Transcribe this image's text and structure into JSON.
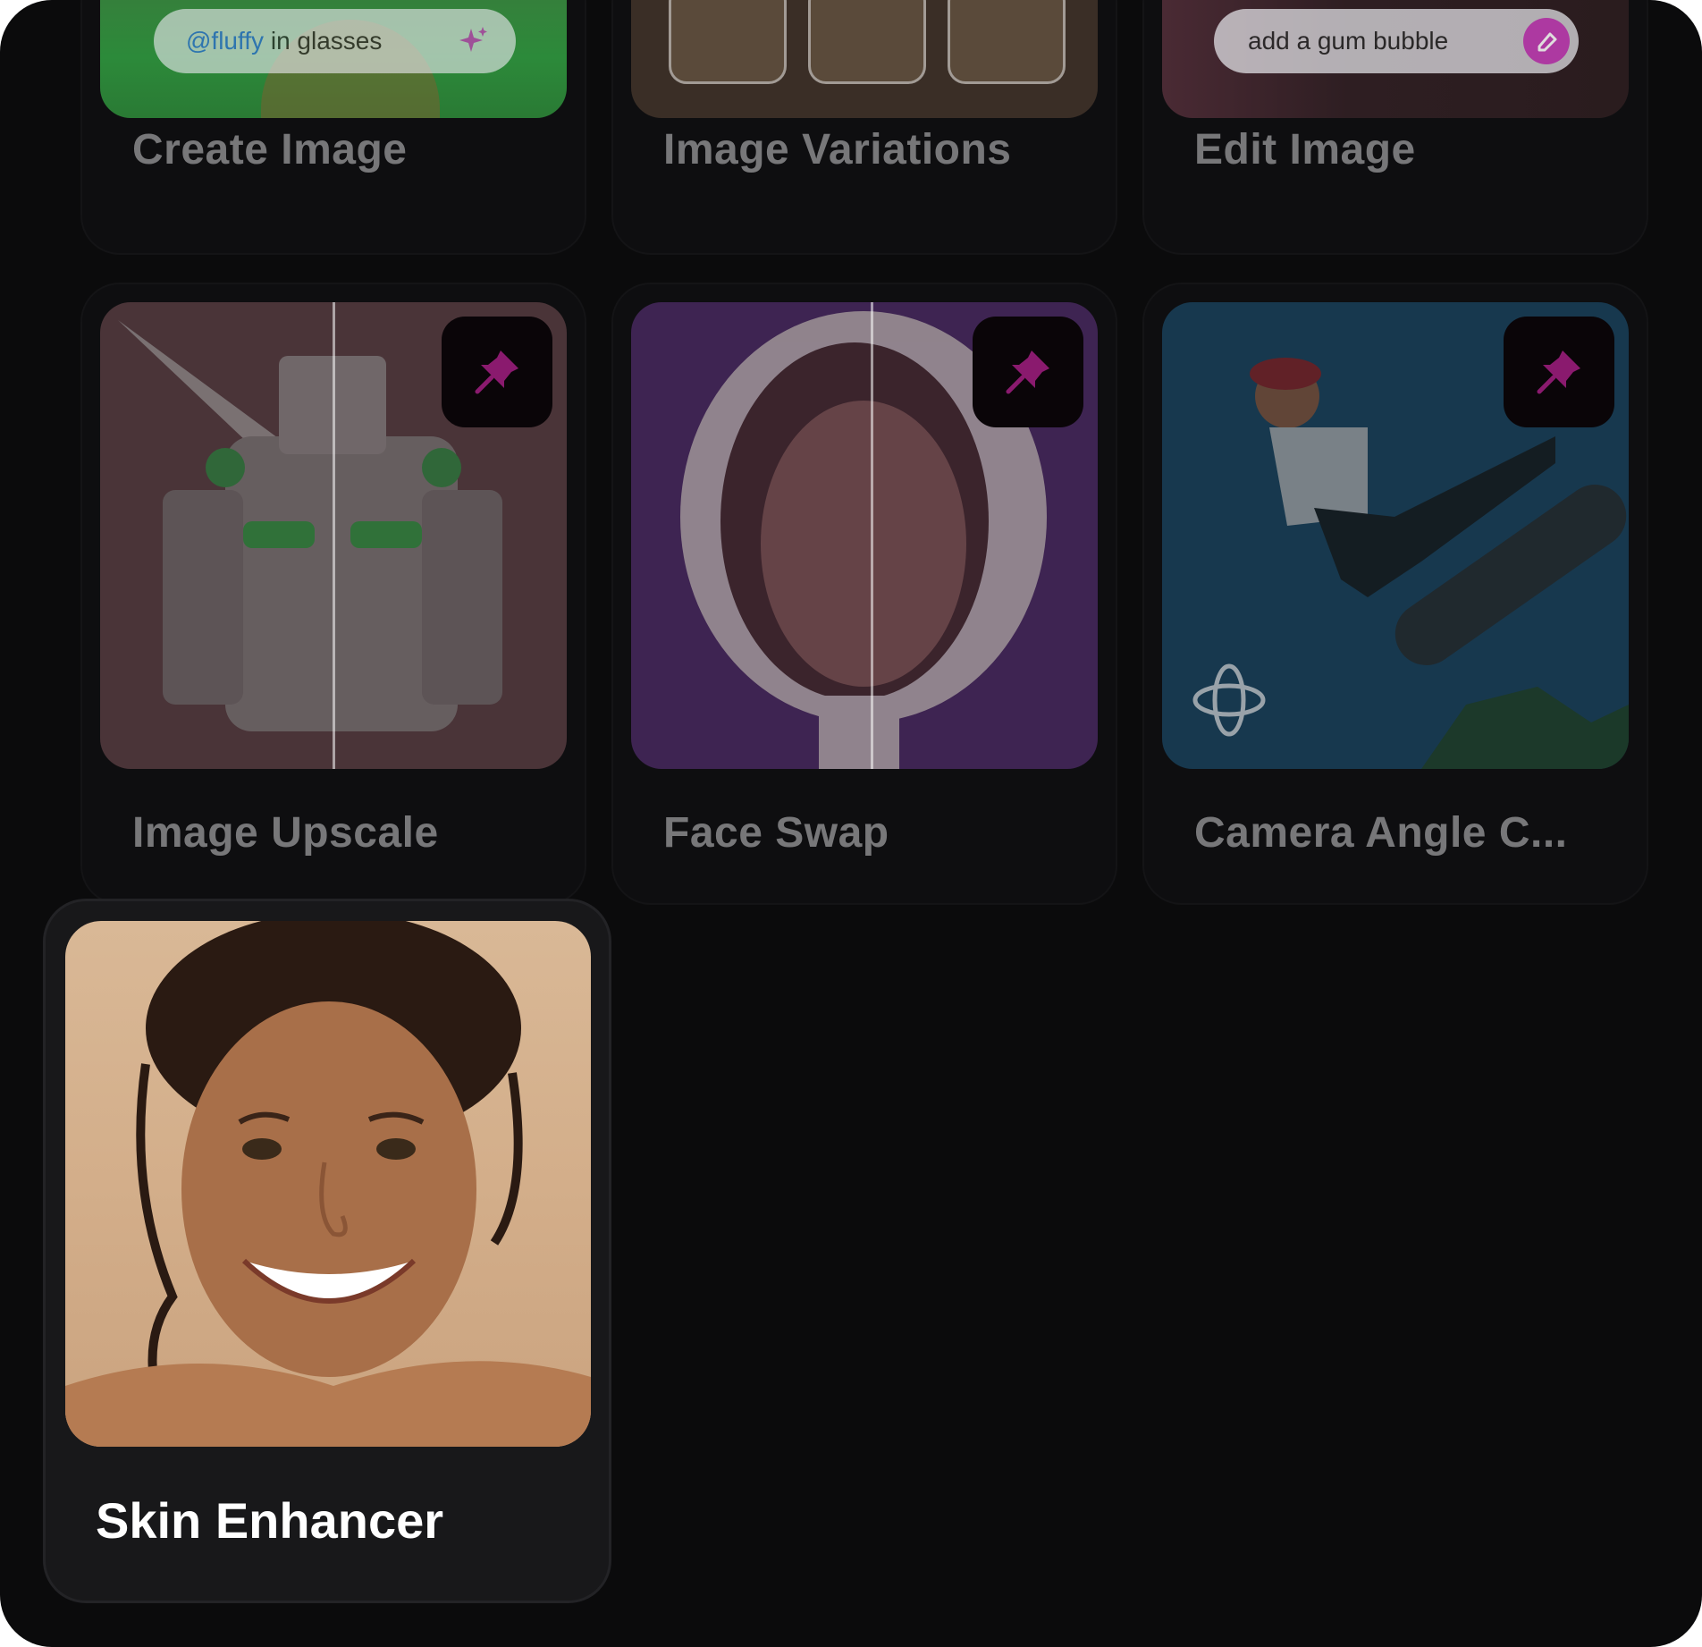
{
  "tools": [
    {
      "title": "Create Image",
      "prompt": {
        "mention": "@fluffy",
        "text": " in glasses"
      }
    },
    {
      "title": "Image Variations"
    },
    {
      "title": "Edit Image",
      "prompt": {
        "text": "add a gum bubble"
      }
    },
    {
      "title": "Image Upscale"
    },
    {
      "title": "Face Swap"
    },
    {
      "title": "Camera Angle C..."
    }
  ],
  "selected_tool": {
    "title": "Skin Enhancer"
  },
  "colors": {
    "background": "#0b0b0c",
    "card": "#0e0e10",
    "selected_card": "#18181a",
    "pin_accent": "#8a1a6e",
    "mention": "#2e6fd6",
    "edit_accent": "#c43fb8"
  },
  "icons": {
    "pin": "pushpin-icon",
    "sparkle": "sparkle-icon",
    "eraser": "eraser-icon",
    "camera_rotate": "camera-rotate-icon"
  }
}
